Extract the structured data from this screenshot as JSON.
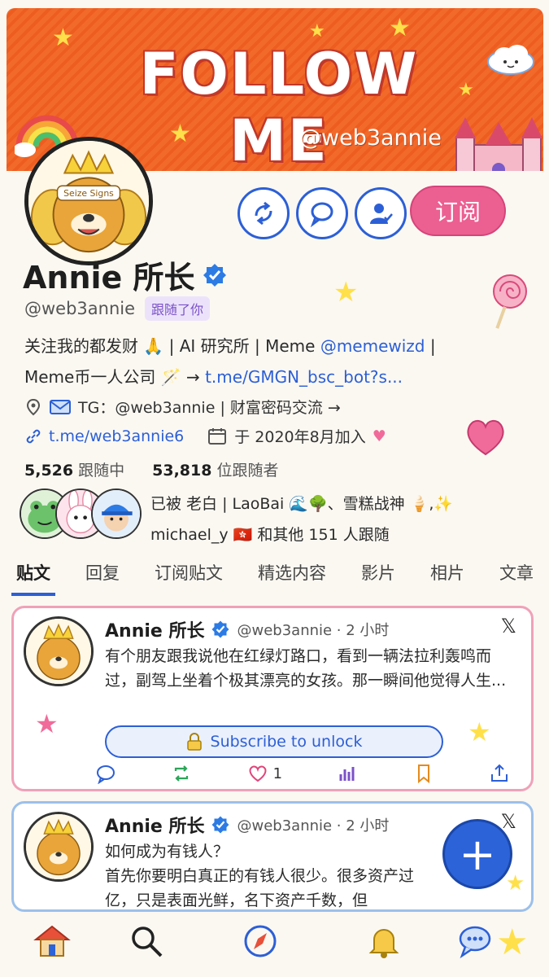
{
  "banner": {
    "title": "FOLLOW ME",
    "handle": "@web3annie"
  },
  "avatar": {
    "badge_text": "Seize Signs"
  },
  "actions": {
    "subscribe_label": "订阅"
  },
  "profile": {
    "name": "Annie 所长",
    "handle": "@web3annie",
    "follows_you": "跟随了你",
    "bio_line1": "关注我的都发财 🙏 | AI 研究所 | Meme ",
    "bio_mention": "@memewizd",
    "bio_line1_end": " |",
    "bio_line2": "Meme币一人公司 🪄 → ",
    "bio_link": "t.me/GMGN_bsc_bot?s...",
    "meta_tg": "TG：@web3annie | 财富密码交流 →",
    "website": "t.me/web3annie6",
    "joined": "于 2020年8月加入",
    "following_count": "5,526",
    "following_label": "跟随中",
    "followers_count": "53,818",
    "followers_label": "位跟随者",
    "followed_by_line1": "已被 老白 | LaoBai 🌊🌳、雪糕战神 🍦,✨",
    "followed_by_line2": "michael_y 🇭🇰 和其他 151 人跟随"
  },
  "tabs": [
    {
      "label": "贴文",
      "active": true
    },
    {
      "label": "回复",
      "active": false
    },
    {
      "label": "订阅贴文",
      "active": false
    },
    {
      "label": "精选内容",
      "active": false
    },
    {
      "label": "影片",
      "active": false
    },
    {
      "label": "相片",
      "active": false
    },
    {
      "label": "文章",
      "active": false
    }
  ],
  "posts": [
    {
      "name": "Annie 所长",
      "meta": "@web3annie · 2 小时",
      "text": "有个朋友跟我说他在红绿灯路口，看到一辆法拉利轰鸣而过，副驾上坐着个极其漂亮的女孩。那一瞬间他觉得人生...",
      "unlock_label": "Subscribe to unlock",
      "likes": "1"
    },
    {
      "name": "Annie 所长",
      "meta": "@web3annie · 2 小时",
      "text_line1": "如何成为有钱人？",
      "text_line2": "首先你要明白真正的有钱人很少。很多资产过亿，只是表面光鲜，名下资产千数，但"
    }
  ],
  "fab_label": "+",
  "colors": {
    "accent": "#2c5fd6",
    "banner": "#f26a2a",
    "subscribe": "#ec5f91",
    "follows_you_bg": "#ece3fb"
  },
  "icons": {
    "nav": [
      "home-icon",
      "search-icon",
      "explore-icon",
      "notifications-icon",
      "messages-icon"
    ]
  }
}
